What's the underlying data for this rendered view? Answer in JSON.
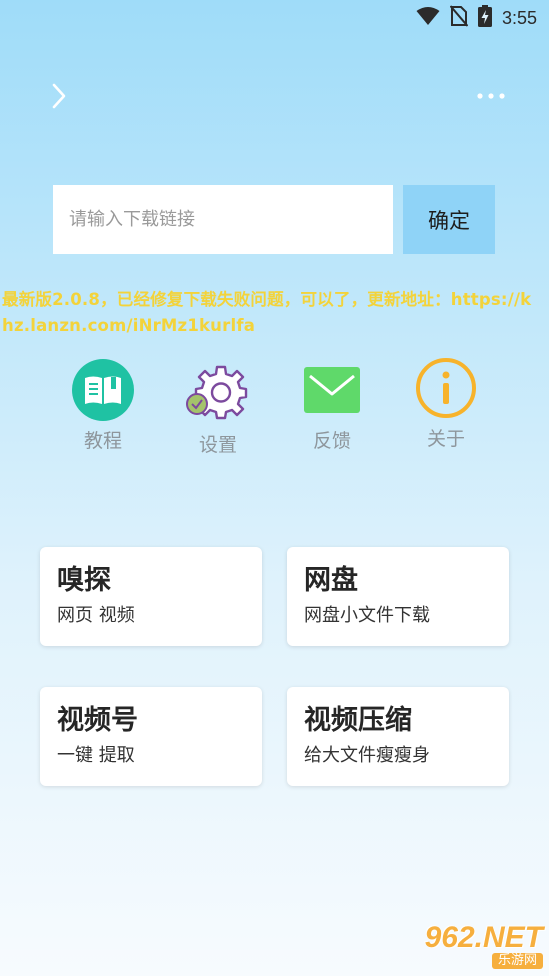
{
  "status_bar": {
    "time": "3:55",
    "icons": [
      "wifi-icon",
      "no-sim-icon",
      "battery-charging-icon"
    ]
  },
  "nav": {
    "back_icon": "chevron-right-icon",
    "more_icon": "more-dots-icon"
  },
  "search": {
    "placeholder": "请输入下载链接",
    "value": "",
    "confirm_label": "确定"
  },
  "notice": {
    "text": "最新版2.0.8，已经修复下载失败问题，可以了，更新地址：https://khz.lanzn.com/iNrMz1kurlfa",
    "color": "#f3d33a"
  },
  "menu": [
    {
      "label": "教程",
      "icon": "book-icon"
    },
    {
      "label": "设置",
      "icon": "gear-icon"
    },
    {
      "label": "反馈",
      "icon": "mail-icon"
    },
    {
      "label": "关于",
      "icon": "info-icon"
    }
  ],
  "cards": [
    {
      "title": "嗅探",
      "subtitle": "网页 视频"
    },
    {
      "title": "网盘",
      "subtitle": "网盘小文件下载"
    },
    {
      "title": "视频号",
      "subtitle": "一键 提取"
    },
    {
      "title": "视频压缩",
      "subtitle": "给大文件瘦瘦身"
    }
  ],
  "watermark": {
    "logo": "962.NET",
    "sub": "乐游网"
  },
  "colors": {
    "accent": "#8fd3f7",
    "notice": "#f3d33a",
    "book": "#1fc2a3",
    "gear": "#7c4a9e",
    "mail": "#5fd96a",
    "info": "#f7b32b"
  }
}
